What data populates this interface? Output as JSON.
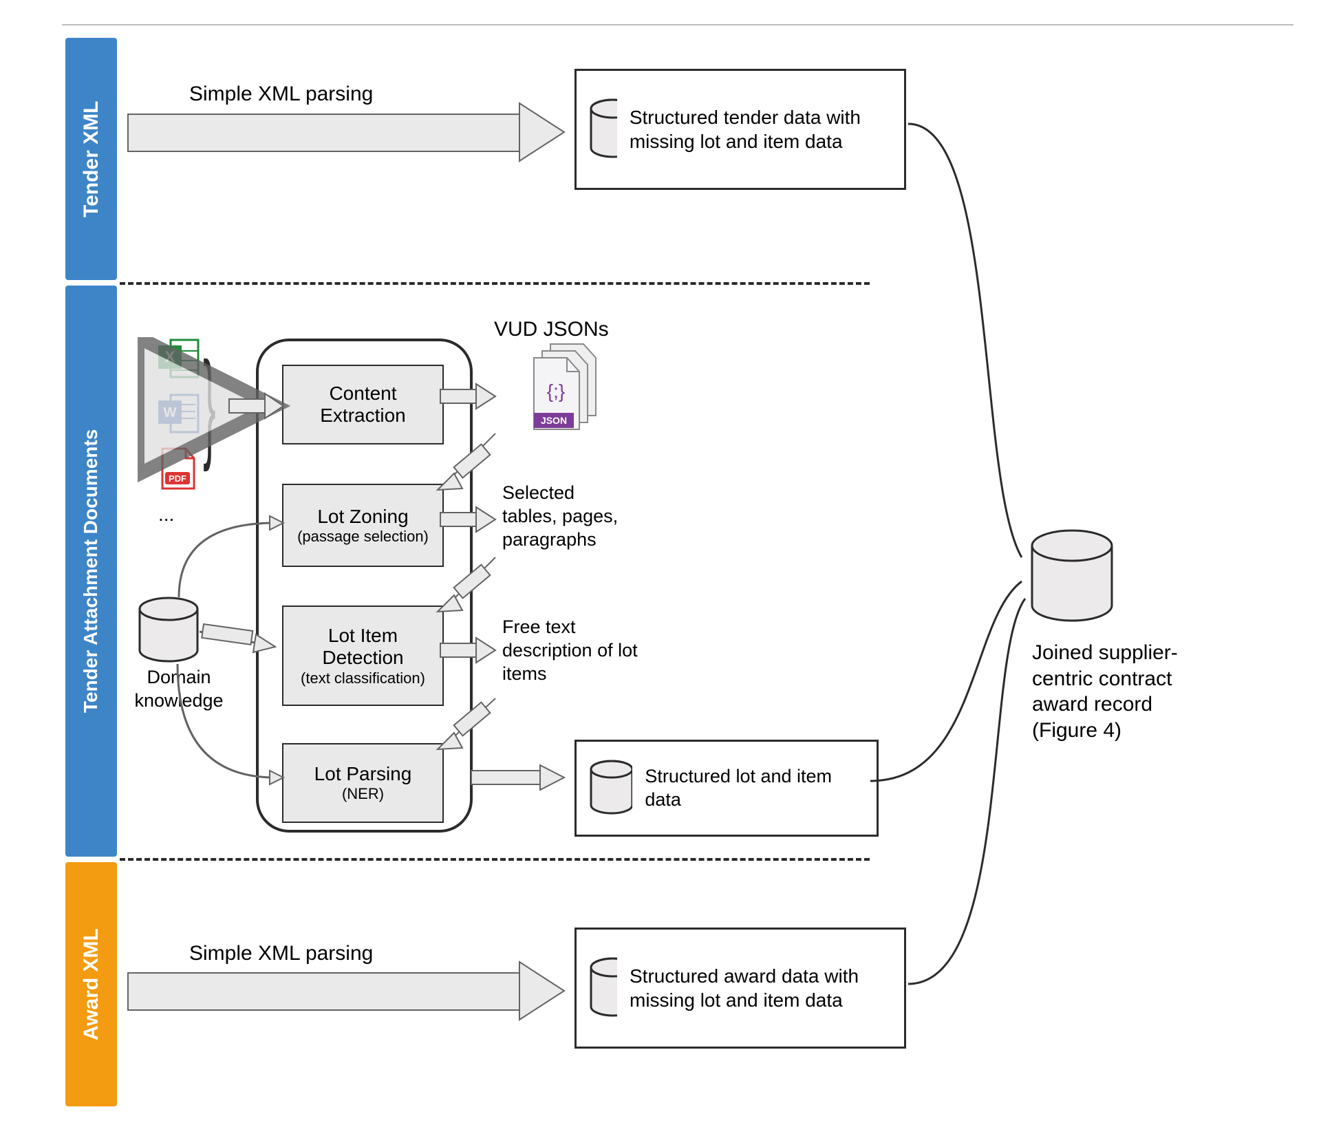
{
  "lanes": {
    "tender": "Tender XML",
    "attachments": "Tender Attachment Documents",
    "award": "Award XML"
  },
  "arrows": {
    "tender_top": "Simple XML parsing",
    "award_bottom": "Simple XML parsing"
  },
  "boxes": {
    "tender_out": "Structured tender data with missing lot and item data",
    "lot_out": "Structured lot and item data",
    "award_out": "Structured award data with missing lot and item data"
  },
  "pipeline": {
    "json_label": "VUD JSONs",
    "steps": {
      "content_extraction": {
        "title": "Content",
        "title2": "Extraction",
        "sub": ""
      },
      "lot_zoning": {
        "title": "Lot Zoning",
        "sub": "(passage selection)"
      },
      "lot_item_detection": {
        "title": "Lot Item",
        "title2": "Detection",
        "sub": "(text classification)"
      },
      "lot_parsing": {
        "title": "Lot Parsing",
        "sub": "(NER)"
      }
    },
    "outputs": {
      "selected": "Selected tables, pages, paragraphs",
      "freetext": "Free text description of lot items"
    },
    "inputs": {
      "domain_label": "Domain knowledge",
      "ellipsis": "..."
    }
  },
  "join": {
    "db_label": "Joined supplier-centric contract award record (Figure 4)"
  },
  "iconfiles": {
    "excel": "xlsx",
    "word": "docx",
    "pdf": "pdf"
  }
}
